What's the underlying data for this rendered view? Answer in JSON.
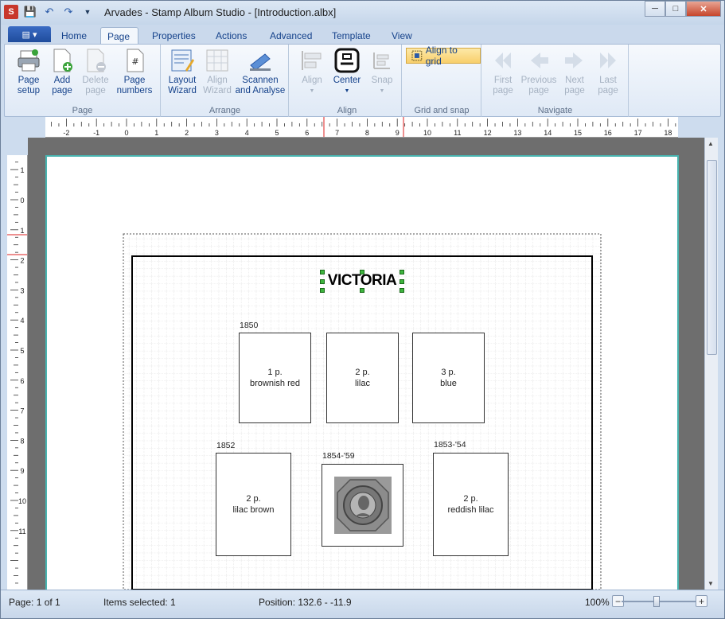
{
  "window": {
    "title": "Arvades - Stamp Album Studio - [Introduction.albx]"
  },
  "file_tab": "",
  "tabs": [
    "Home",
    "Page",
    "Properties",
    "Actions",
    "Advanced",
    "Template",
    "View"
  ],
  "ribbon": {
    "page_group": {
      "label": "Page",
      "setup": "Page setup",
      "add": "Add page",
      "delete": "Delete page",
      "numbers": "Page numbers"
    },
    "arrange_group": {
      "label": "Arrange",
      "layout": "Layout Wizard",
      "align_wizard": "Align Wizard",
      "scan": "Scannen and Analyse"
    },
    "align_group": {
      "label": "Align",
      "align": "Align",
      "center": "Center",
      "snap": "Snap"
    },
    "grid_group": {
      "label": "Grid and snap",
      "align_to_grid": "Align to grid"
    },
    "navigate_group": {
      "label": "Navigate",
      "first": "First page",
      "previous": "Previous page",
      "next": "Next page",
      "last": "Last page"
    }
  },
  "ruler": {
    "h_labels": [
      "-2",
      "-1",
      "0",
      "1",
      "2",
      "3",
      "4",
      "5",
      "6",
      "7",
      "8",
      "9",
      "10",
      "11",
      "12",
      "13",
      "14",
      "15",
      "16",
      "17",
      "18"
    ],
    "v_labels": [
      "2",
      "1",
      "0",
      "1",
      "2",
      "3",
      "4",
      "5",
      "6",
      "7",
      "8",
      "9",
      "10",
      "11"
    ]
  },
  "album": {
    "heading": "VICTORIA",
    "row1_year": "1850",
    "row2_year_a": "1852",
    "row2_year_b": "1854-'59",
    "row2_year_c": "1853-'54",
    "stamps": [
      {
        "value": "1 p.",
        "color": "brownish red"
      },
      {
        "value": "2 p.",
        "color": "lilac"
      },
      {
        "value": "3 p.",
        "color": "blue"
      },
      {
        "value": "2 p.",
        "color": "lilac brown"
      },
      {
        "value": "2 p.",
        "color": "reddish lilac"
      }
    ]
  },
  "status": {
    "page": "Page: 1 of 1",
    "items": "Items selected: 1",
    "position": "Position: 132.6 - -11.9",
    "zoom": "100%"
  }
}
